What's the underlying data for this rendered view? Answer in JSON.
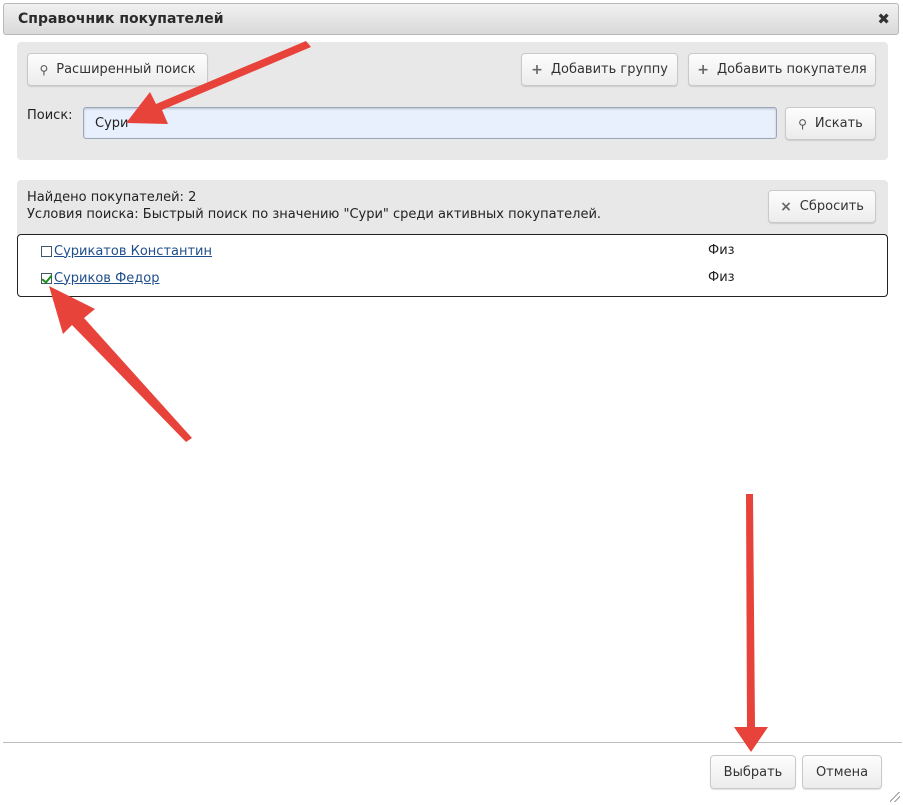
{
  "dialog": {
    "title": "Справочник покупателей",
    "close_glyph": "✖"
  },
  "toolbar": {
    "advanced_search_label": "Расширенный поиск",
    "add_group_label": "Добавить группу",
    "add_customer_label": "Добавить покупателя"
  },
  "search": {
    "label": "Поиск:",
    "value": "Сури",
    "button_label": "Искать"
  },
  "results_info": {
    "found": "Найдено покупателей: 2",
    "conditions": "Условия поиска: Быстрый поиск по значению \"Сури\" среди активных покупателей.",
    "reset_label": "Сбросить"
  },
  "customers": [
    {
      "name": "Сурикатов Константин",
      "type": "Физ",
      "checked": false
    },
    {
      "name": "Суриков Федор",
      "type": "Физ",
      "checked": true
    }
  ],
  "footer": {
    "select_label": "Выбрать",
    "cancel_label": "Отмена"
  },
  "colors": {
    "annotation_arrow": "#e8433a",
    "input_background": "#e8f0fe",
    "link": "#1f4e8c"
  }
}
